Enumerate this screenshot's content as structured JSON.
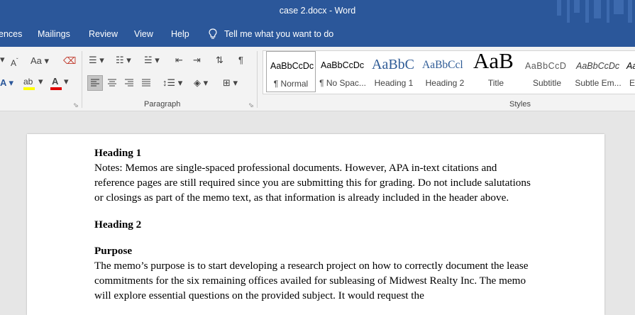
{
  "window": {
    "title": "case 2.docx  -  Word"
  },
  "tabs": [
    "ences",
    "Mailings",
    "Review",
    "View",
    "Help"
  ],
  "tell_me": "Tell me what you want to do",
  "ribbon": {
    "font_size_label": "Aa",
    "paragraph_group": "Paragraph",
    "styles_group": "Styles",
    "styles": [
      {
        "preview": "AaBbCcDc",
        "name": "¶ Normal"
      },
      {
        "preview": "AaBbCcDc",
        "name": "¶ No Spac..."
      },
      {
        "preview": "AaBbC",
        "name": "Heading 1"
      },
      {
        "preview": "AaBbCcl",
        "name": "Heading 2"
      },
      {
        "preview": "AaB",
        "name": "Title"
      },
      {
        "preview": "AaBbCcD",
        "name": "Subtitle"
      },
      {
        "preview": "AaBbCcDc",
        "name": "Subtle Em..."
      },
      {
        "preview": "Aa",
        "name": "E"
      }
    ]
  },
  "colors": {
    "accent": "#2b579a",
    "highlight": "#ffff00",
    "font_color": "#e00000"
  },
  "document": {
    "heading1": "Heading 1",
    "notes": "Notes: Memos are single-spaced professional documents. However, APA in-text citations and reference pages are still required since you are submitting this for grading. Do not include salutations or closings as part of the memo text, as that information is already included in the header above.",
    "heading2": "Heading 2",
    "purpose_heading": "Purpose",
    "purpose_text": "The memo’s purpose is to start developing a research project on how to correctly document the lease commitments for the six remaining offices availed for subleasing of Midwest Realty Inc. The memo will explore essential questions on the provided subject. It would request the"
  }
}
